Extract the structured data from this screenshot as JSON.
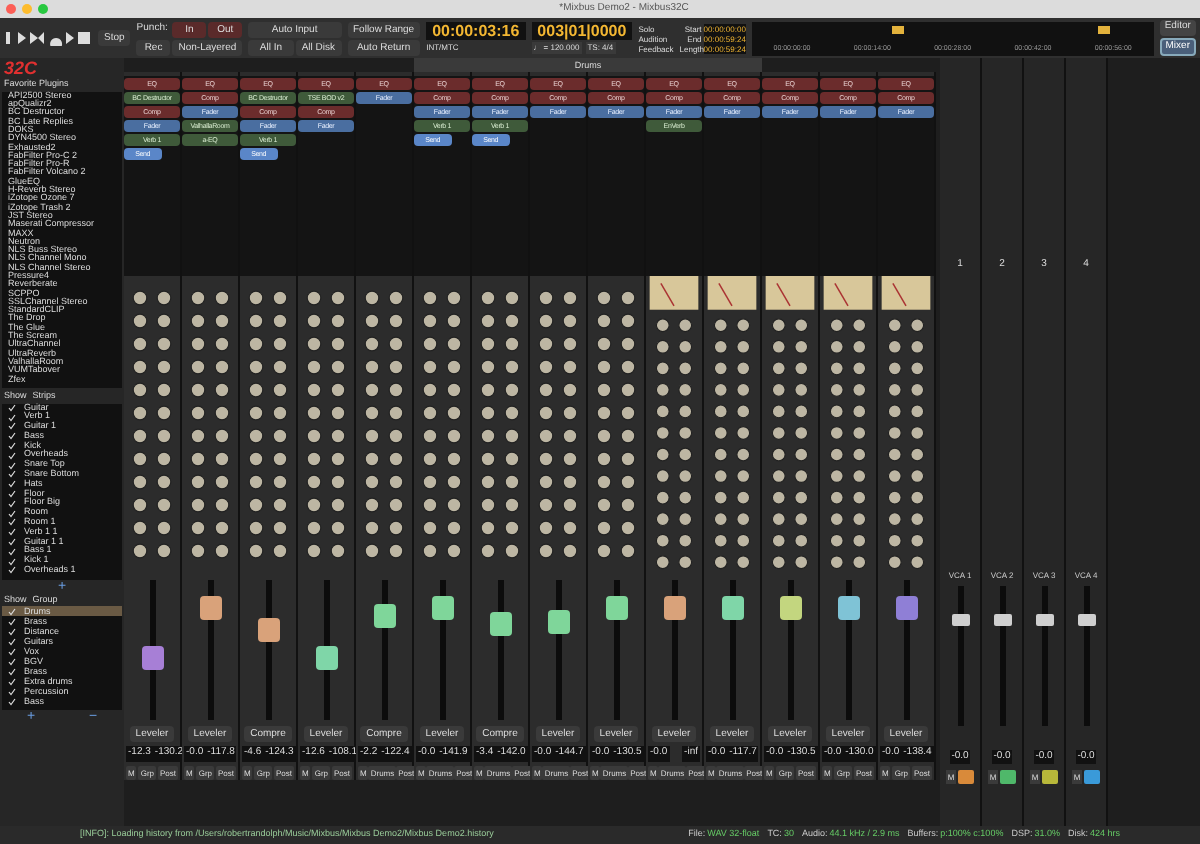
{
  "window": {
    "title": "*Mixbus Demo2 - Mixbus32C"
  },
  "toolbar": {
    "punch_label": "Punch:",
    "punch_in": "In",
    "punch_out": "Out",
    "auto_input": "Auto Input",
    "follow_range": "Follow Range",
    "rec": "Rec",
    "non_layered": "Non-Layered",
    "all_in": "All In",
    "all_disk": "All Disk",
    "auto_return": "Auto Return",
    "sync": "INT/MTC",
    "stop": "Stop",
    "timecode": "00:00:03:16",
    "bbt": "003|01|0000",
    "tempo": "♩ = 120.000",
    "meter": "TS: 4/4",
    "solo_buttons": [
      "Solo",
      "Audition",
      "Feedback"
    ],
    "range": [
      {
        "label": "Start",
        "value": "00:00:00:00"
      },
      {
        "label": "End",
        "value": "00:00:59:24"
      },
      {
        "label": "Length",
        "value": "00:00:59:24"
      }
    ],
    "ruler": [
      "00:00:00:00",
      "00:00:14:00",
      "00:00:28:00",
      "00:00:42:00",
      "00:00:56:00"
    ],
    "views": [
      {
        "label": "Editor",
        "selected": false
      },
      {
        "label": "Mixer",
        "selected": true
      }
    ]
  },
  "logo": "32C",
  "favorites": {
    "title": "Favorite Plugins",
    "items": [
      "API2500 Stereo",
      "apQualizr2",
      "BC Destructor",
      "BC Late Replies",
      "DOKS",
      "DYN4500 Stereo",
      "Exhausted2",
      "FabFilter Pro-C 2",
      "FabFilter Pro-R",
      "FabFilter Volcano 2",
      "GlueEQ",
      "H-Reverb Stereo",
      "iZotope Ozone 7",
      "iZotope Trash 2",
      "JST Stereo",
      "Maserati Compressor",
      "MAXX",
      "Neutron",
      "NLS Buss Stereo",
      "NLS Channel Mono",
      "NLS Channel Stereo",
      "Pressure4",
      "Reverberate",
      "SCPPO",
      "SSLChannel Stereo",
      "StandardCLIP",
      "The Drop",
      "The Glue",
      "The Scream",
      "UltraChannel",
      "UltraReverb",
      "ValhallaRoom",
      "VUMTabover",
      "Zfex"
    ]
  },
  "strips_list": {
    "columns": [
      "Show",
      "Strips"
    ],
    "items": [
      {
        "name": "Guitar",
        "checked": true
      },
      {
        "name": "Verb 1",
        "checked": true
      },
      {
        "name": "Guitar 1",
        "checked": true
      },
      {
        "name": "Bass",
        "checked": true
      },
      {
        "name": "Kick",
        "checked": true
      },
      {
        "name": "Overheads",
        "checked": true
      },
      {
        "name": "Snare Top",
        "checked": true
      },
      {
        "name": "Snare Bottom",
        "checked": true
      },
      {
        "name": "Hats",
        "checked": true
      },
      {
        "name": "Floor",
        "checked": true
      },
      {
        "name": "Floor Big",
        "checked": true
      },
      {
        "name": "Room",
        "checked": true
      },
      {
        "name": "Room 1",
        "checked": true
      },
      {
        "name": "Verb 1 1",
        "checked": true
      },
      {
        "name": "Guitar 1 1",
        "checked": true
      },
      {
        "name": "Bass 1",
        "checked": true
      },
      {
        "name": "Kick 1",
        "checked": true
      },
      {
        "name": "Overheads 1",
        "checked": true
      }
    ],
    "add": "+"
  },
  "groups_list": {
    "columns": [
      "Show",
      "Group"
    ],
    "items": [
      {
        "name": "Drums",
        "checked": true,
        "selected": true
      },
      {
        "name": "Brass",
        "checked": true,
        "selected": false
      },
      {
        "name": "Distance",
        "checked": true,
        "selected": false
      },
      {
        "name": "Guitars",
        "checked": true,
        "selected": false
      },
      {
        "name": "Vox",
        "checked": true,
        "selected": false
      },
      {
        "name": "BGV",
        "checked": true,
        "selected": false
      },
      {
        "name": "Brass",
        "checked": true,
        "selected": false
      },
      {
        "name": "Extra drums",
        "checked": true,
        "selected": false
      },
      {
        "name": "Percussion",
        "checked": true,
        "selected": false
      },
      {
        "name": "Bass",
        "checked": true,
        "selected": false
      }
    ],
    "add": "+",
    "remove": "−"
  },
  "group_tab": "Drums",
  "strips": [
    {
      "processors": [
        {
          "label": "EQ",
          "kind": "builtin"
        },
        {
          "label": "BC Destructor",
          "kind": "plugin"
        },
        {
          "label": "Comp",
          "kind": "builtin"
        },
        {
          "label": "Fader",
          "kind": "fader"
        },
        {
          "label": "Verb 1",
          "kind": "plugin"
        },
        {
          "label": "Send",
          "kind": "send"
        }
      ],
      "vu": false,
      "mode": "Leveler",
      "gain": "-12.3",
      "peak": "-130.2",
      "buttons": [
        "M",
        "Grp",
        "Post"
      ],
      "color": "#a77fd6",
      "level": 0.45
    },
    {
      "processors": [
        {
          "label": "EQ",
          "kind": "builtin"
        },
        {
          "label": "Comp",
          "kind": "builtin"
        },
        {
          "label": "Fader",
          "kind": "fader"
        },
        {
          "label": "ValhallaRoom",
          "kind": "plugin"
        },
        {
          "label": "a-EQ",
          "kind": "plugin"
        }
      ],
      "vu": false,
      "mode": "Leveler",
      "gain": "-0.0",
      "peak": "-117.8",
      "buttons": [
        "M",
        "Grp",
        "Post"
      ],
      "color": "#d9a27a",
      "level": 0.8
    },
    {
      "processors": [
        {
          "label": "EQ",
          "kind": "builtin"
        },
        {
          "label": "BC Destructor",
          "kind": "plugin"
        },
        {
          "label": "Comp",
          "kind": "builtin"
        },
        {
          "label": "Fader",
          "kind": "fader"
        },
        {
          "label": "Verb 1",
          "kind": "plugin"
        },
        {
          "label": "Send",
          "kind": "send"
        }
      ],
      "vu": false,
      "mode": "Compre",
      "gain": "-4.6",
      "peak": "-124.3",
      "buttons": [
        "M",
        "Grp",
        "Post"
      ],
      "color": "#d9a27a",
      "level": 0.65
    },
    {
      "processors": [
        {
          "label": "EQ",
          "kind": "builtin"
        },
        {
          "label": "TSE BOD v2",
          "kind": "plugin"
        },
        {
          "label": "Comp",
          "kind": "builtin"
        },
        {
          "label": "Fader",
          "kind": "fader"
        }
      ],
      "vu": false,
      "mode": "Leveler",
      "gain": "-12.6",
      "peak": "-108.1",
      "buttons": [
        "M",
        "Grp",
        "Post"
      ],
      "color": "#7fd6a8",
      "level": 0.45
    },
    {
      "processors": [
        {
          "label": "EQ",
          "kind": "builtin"
        },
        {
          "label": "Fader",
          "kind": "fader"
        }
      ],
      "vu": false,
      "mode": "Compre",
      "gain": "-2.2",
      "peak": "-122.4",
      "buttons": [
        "M",
        "Drums",
        "Post"
      ],
      "color": "#7fd69a",
      "level": 0.75
    },
    {
      "processors": [
        {
          "label": "EQ",
          "kind": "builtin"
        },
        {
          "label": "Comp",
          "kind": "builtin"
        },
        {
          "label": "Fader",
          "kind": "fader"
        },
        {
          "label": "Verb 1",
          "kind": "plugin"
        },
        {
          "label": "Send",
          "kind": "send"
        }
      ],
      "vu": false,
      "mode": "Leveler",
      "gain": "-0.0",
      "peak": "-141.9",
      "buttons": [
        "M",
        "Drums",
        "Post"
      ],
      "color": "#7fd69a",
      "level": 0.8
    },
    {
      "processors": [
        {
          "label": "EQ",
          "kind": "builtin"
        },
        {
          "label": "Comp",
          "kind": "builtin"
        },
        {
          "label": "Fader",
          "kind": "fader"
        },
        {
          "label": "Verb 1",
          "kind": "plugin"
        },
        {
          "label": "Send",
          "kind": "send"
        }
      ],
      "vu": false,
      "mode": "Compre",
      "gain": "-3.4",
      "peak": "-142.0",
      "buttons": [
        "M",
        "Drums",
        "Post"
      ],
      "color": "#7fd69a",
      "level": 0.68
    },
    {
      "processors": [
        {
          "label": "EQ",
          "kind": "builtin"
        },
        {
          "label": "Comp",
          "kind": "builtin"
        },
        {
          "label": "Fader",
          "kind": "fader"
        }
      ],
      "vu": false,
      "mode": "Leveler",
      "gain": "-0.0",
      "peak": "-144.7",
      "buttons": [
        "M",
        "Drums",
        "Post"
      ],
      "color": "#7fd69a",
      "level": 0.7
    },
    {
      "processors": [
        {
          "label": "EQ",
          "kind": "builtin"
        },
        {
          "label": "Comp",
          "kind": "builtin"
        },
        {
          "label": "Fader",
          "kind": "fader"
        }
      ],
      "vu": false,
      "mode": "Leveler",
      "gain": "-0.0",
      "peak": "-130.5",
      "buttons": [
        "M",
        "Drums",
        "Post"
      ],
      "color": "#7fd69a",
      "level": 0.8
    },
    {
      "processors": [
        {
          "label": "EQ",
          "kind": "builtin"
        },
        {
          "label": "Comp",
          "kind": "builtin"
        },
        {
          "label": "Fader",
          "kind": "fader"
        },
        {
          "label": "EnVerb",
          "kind": "plugin"
        }
      ],
      "vu": true,
      "mode": "Leveler",
      "gain": "-0.0",
      "peak": "-inf",
      "buttons": [
        "M",
        "Drums",
        "Post"
      ],
      "color": "#d9a27a",
      "level": 0.8
    },
    {
      "processors": [
        {
          "label": "EQ",
          "kind": "builtin"
        },
        {
          "label": "Comp",
          "kind": "builtin"
        },
        {
          "label": "Fader",
          "kind": "fader"
        }
      ],
      "vu": true,
      "mode": "Leveler",
      "gain": "-0.0",
      "peak": "-117.7",
      "buttons": [
        "M",
        "Drums",
        "Post"
      ],
      "color": "#7fd6a8",
      "level": 0.8
    },
    {
      "processors": [
        {
          "label": "EQ",
          "kind": "builtin"
        },
        {
          "label": "Comp",
          "kind": "builtin"
        },
        {
          "label": "Fader",
          "kind": "fader"
        }
      ],
      "vu": true,
      "mode": "Leveler",
      "gain": "-0.0",
      "peak": "-130.5",
      "buttons": [
        "M",
        "Grp",
        "Post"
      ],
      "color": "#c3d67f",
      "level": 0.8
    },
    {
      "processors": [
        {
          "label": "EQ",
          "kind": "builtin"
        },
        {
          "label": "Comp",
          "kind": "builtin"
        },
        {
          "label": "Fader",
          "kind": "fader"
        }
      ],
      "vu": true,
      "mode": "Leveler",
      "gain": "-0.0",
      "peak": "-130.0",
      "buttons": [
        "M",
        "Grp",
        "Post"
      ],
      "color": "#7fc3d6",
      "level": 0.8
    },
    {
      "processors": [
        {
          "label": "EQ",
          "kind": "builtin"
        },
        {
          "label": "Comp",
          "kind": "builtin"
        },
        {
          "label": "Fader",
          "kind": "fader"
        }
      ],
      "vu": true,
      "mode": "Leveler",
      "gain": "-0.0",
      "peak": "-138.4",
      "buttons": [
        "M",
        "Grp",
        "Post"
      ],
      "color": "#8f7fd6",
      "level": 0.8
    }
  ],
  "buses": [
    {
      "number": "1",
      "name": "VCA 1",
      "value": "-0.0",
      "mute": "M",
      "color": "#d98a3a",
      "level": 0.75
    },
    {
      "number": "2",
      "name": "VCA 2",
      "value": "-0.0",
      "mute": "M",
      "color": "#4fb86a",
      "level": 0.75
    },
    {
      "number": "3",
      "name": "VCA 3",
      "value": "-0.0",
      "mute": "M",
      "color": "#b8b83a",
      "level": 0.75
    },
    {
      "number": "4",
      "name": "VCA 4",
      "value": "-0.0",
      "mute": "M",
      "color": "#3a9ad9",
      "level": 0.75
    }
  ],
  "status_bar": {
    "message": "[INFO]: Loading history from /Users/robertrandolph/Music/Mixbus/Mixbus Demo2/Mixbus Demo2.history",
    "fields": [
      {
        "label": "File:",
        "value": "WAV 32-float"
      },
      {
        "label": "TC:",
        "value": "30"
      },
      {
        "label": "Audio:",
        "value": "44.1 kHz / 2.9 ms"
      },
      {
        "label": "Buffers:",
        "value": "p:100% c:100%"
      },
      {
        "label": "DSP:",
        "value": "31.0%"
      },
      {
        "label": "Disk:",
        "value": "424 hrs"
      }
    ]
  }
}
